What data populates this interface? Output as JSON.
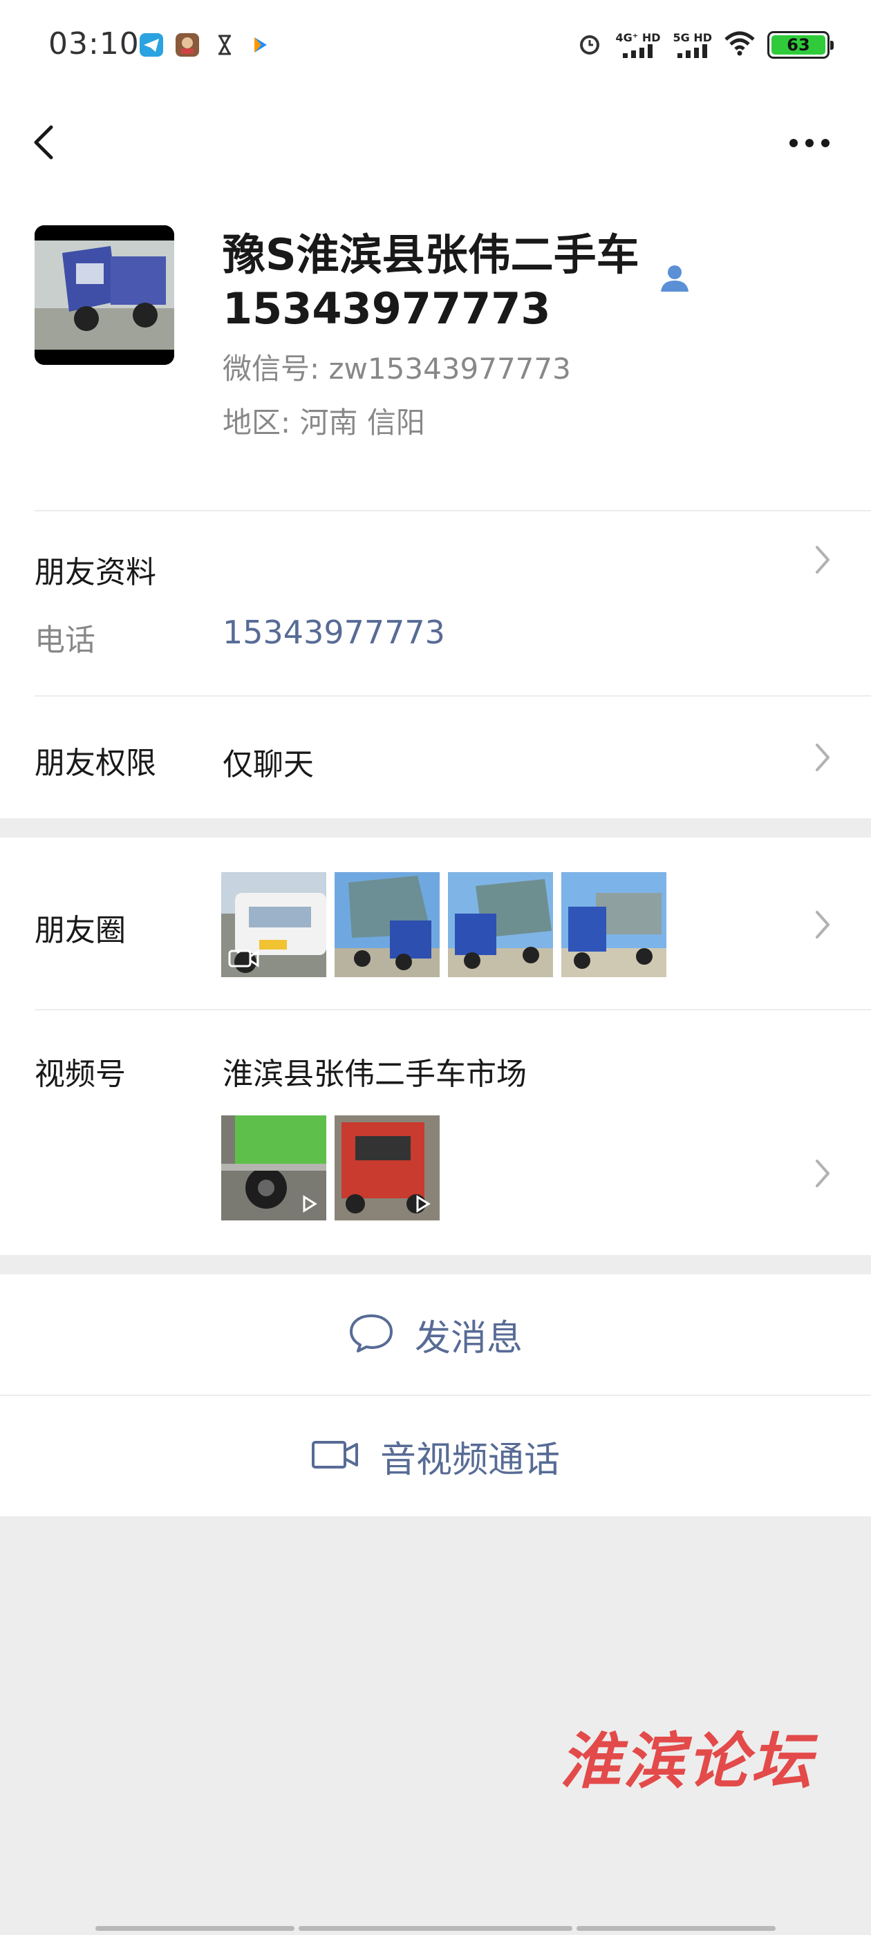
{
  "status_bar": {
    "time": "03:10",
    "signal_1": "4G⁺ HD",
    "signal_2": "5G HD",
    "battery": "63",
    "icons": [
      "telegram-icon",
      "game-app-icon",
      "hourglass-icon",
      "share-app-icon",
      "alarm-icon",
      "wifi-icon"
    ]
  },
  "nav": {
    "back_icon": "chevron-left-icon",
    "more_icon": "more-dots-icon"
  },
  "profile": {
    "name": "豫S淮滨县张伟二手车15343977773",
    "wechat_id": "微信号:  zw15343977773",
    "region": "地区:  河南  信阳"
  },
  "friend_info": {
    "title": "朋友资料",
    "phone_label": "电话",
    "phone": "15343977773"
  },
  "permissions": {
    "title": "朋友权限",
    "value": "仅聊天"
  },
  "moments": {
    "title": "朋友圈"
  },
  "channels": {
    "title": "视频号",
    "name": "淮滨县张伟二手车市场"
  },
  "actions": {
    "message": "发消息",
    "call": "音视频通话"
  },
  "watermark": "淮滨论坛",
  "colors": {
    "accent": "#576b95",
    "battery": "#2fcb3b",
    "background": "#ededed",
    "watermark": "#e34a4a"
  }
}
